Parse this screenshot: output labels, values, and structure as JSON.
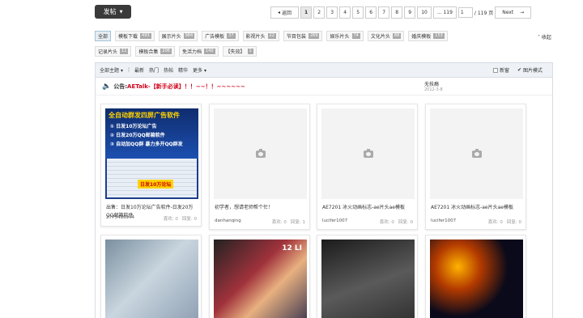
{
  "toolbar": {
    "post_label": "发帖"
  },
  "pager": {
    "back": "返回",
    "pages": [
      "1",
      "2",
      "3",
      "4",
      "5",
      "6",
      "7",
      "8",
      "9",
      "10"
    ],
    "ellipsis": "... 119",
    "input_value": "1",
    "total": "/ 119 页",
    "next": "Next"
  },
  "categories": [
    {
      "label": "全部",
      "count": ""
    },
    {
      "label": "模板下载",
      "count": "493"
    },
    {
      "label": "展示片头",
      "count": "984"
    },
    {
      "label": "广告模板",
      "count": "37"
    },
    {
      "label": "影视片头",
      "count": "22"
    },
    {
      "label": "节目包装",
      "count": "269"
    },
    {
      "label": "娱乐片头",
      "count": "74"
    },
    {
      "label": "文化片头",
      "count": "88"
    },
    {
      "label": "婚庆模板",
      "count": "153"
    },
    {
      "label": "记录片头",
      "count": "11"
    },
    {
      "label": "模板合集",
      "count": "206"
    },
    {
      "label": "免活力档",
      "count": "140"
    },
    {
      "label": "【失效】",
      "count": "1"
    }
  ],
  "collapse_label": "收起",
  "filter": {
    "items": [
      "全部主题",
      "最新",
      "热门",
      "热帖",
      "精华",
      "更多"
    ],
    "new_window": "新窗",
    "image_mode": "图片模式"
  },
  "notice": {
    "label": "公告:",
    "title": "AETalk-【新手必读】！！~~！！~~~~~~",
    "author": "无技瘾",
    "date": "2012-3-8"
  },
  "cards": [
    {
      "title": "出售：日发10万论坛广告软件-日发20万QQ邮箱软件",
      "author": "2775416944",
      "likes": "喜欢: 0",
      "replies": "回复: 0"
    },
    {
      "title": "初学者，想请老师帮个忙！",
      "author": "danhanqing",
      "likes": "喜欢: 0",
      "replies": "回复: 1"
    },
    {
      "title": "AE7201 冰火动画标志-ae片头ae模板",
      "author": "lucifer1007",
      "likes": "喜欢: 0",
      "replies": "回复: 0"
    },
    {
      "title": "AE7201 冰火动画标志-ae片头ae模板",
      "author": "lucifer1007",
      "likes": "喜欢: 0",
      "replies": "回复: 0"
    }
  ],
  "ad": {
    "headline": "全自动群发四屏广告软件",
    "line1": "① 日发10万论坛广告",
    "line2": "② 日发20万QQ邮箱软件",
    "line3": "③ 自动加QQ群 暴力多开QQ群发",
    "badge": "日发10万论坛"
  },
  "row2_labels": {
    "card2": "12 LI"
  },
  "colors": {
    "accent": "#d0021b",
    "button_bg": "#3a3a3a",
    "filter_bg": "#eef2f6"
  }
}
